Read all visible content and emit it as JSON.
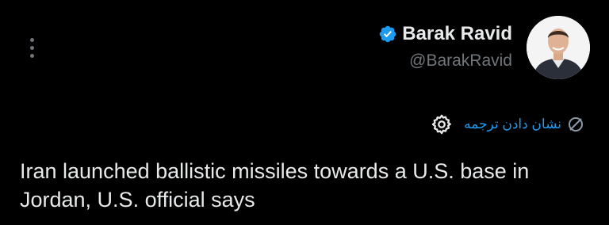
{
  "author": {
    "display_name": "Barak Ravid",
    "handle": "@BarakRavid",
    "verified": true
  },
  "icons": {
    "more": "more-vertical-icon",
    "verified": "verified-badge-icon",
    "translate": "translate-globe-icon",
    "settings": "gear-icon"
  },
  "translate": {
    "label": "نشان دادن ترجمه"
  },
  "tweet": {
    "text": "Iran launched ballistic missiles towards a U.S. base in Jordan, U.S. official says"
  },
  "colors": {
    "background": "#000000",
    "text": "#e7e9ea",
    "secondary": "#71767b",
    "accent": "#1d9bf0"
  }
}
